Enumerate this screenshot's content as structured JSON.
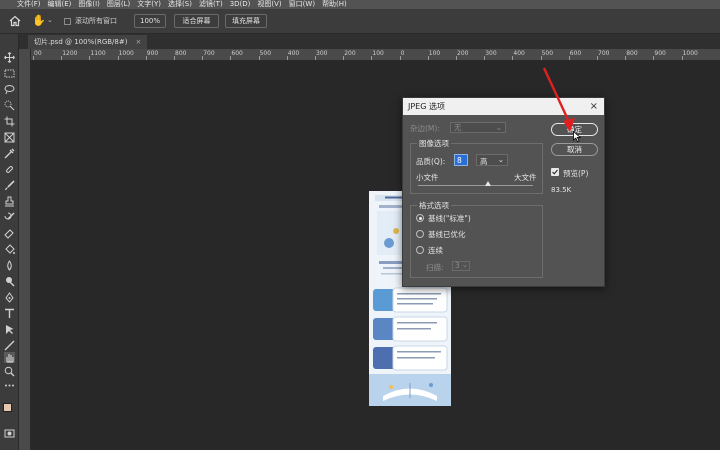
{
  "menu": [
    "文件(F)",
    "编辑(E)",
    "图像(I)",
    "图层(L)",
    "文字(Y)",
    "选择(S)",
    "滤镜(T)",
    "3D(D)",
    "视图(V)",
    "窗口(W)",
    "帮助(H)"
  ],
  "options_bar": {
    "scroll_all_windows": "滚动所有窗口",
    "zoom_level": "100%",
    "fit_screen": "适合屏幕",
    "fill_screen": "填充屏幕"
  },
  "document": {
    "tab_title": "切片.psd @ 100%(RGB/8#)",
    "close_symbol": "×"
  },
  "ruler": {
    "labels": [
      "00",
      "1200",
      "1100",
      "1000",
      "900",
      "800",
      "700",
      "600",
      "500",
      "400",
      "300",
      "200",
      "100",
      "0",
      "100",
      "200",
      "300",
      "400",
      "500",
      "600",
      "700",
      "800",
      "900",
      "1000"
    ]
  },
  "dialog": {
    "title": "JPEG 选项",
    "close_symbol": "×",
    "matte_label": "杂边(M):",
    "matte_value": "无",
    "image_options_legend": "图像选项",
    "quality_label": "品质(Q):",
    "quality_value": "8",
    "quality_preset": "高",
    "small_file": "小文件",
    "large_file": "大文件",
    "format_options_legend": "格式选项",
    "format_baseline_standard": "基线(\"标准\")",
    "format_baseline_optimized": "基线已优化",
    "format_progressive": "连续",
    "scans_label": "扫描:",
    "scans_value": "3",
    "ok_button": "确定",
    "cancel_button": "取消",
    "preview_label": "预览(P)",
    "file_size": "83.5K",
    "quality_slider_value": 0.61
  },
  "colors": {
    "accent": "#2a6fd6",
    "annotation_arrow": "#e02020",
    "foreground_swatch": "#e6c7b0",
    "background_swatch": "#ffffff"
  }
}
